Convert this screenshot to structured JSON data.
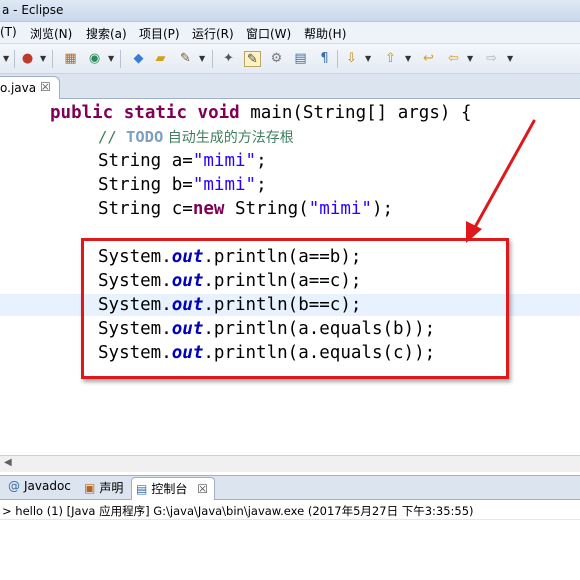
{
  "window": {
    "title": "a - Eclipse"
  },
  "menu": {
    "items": [
      "(T)",
      "浏览(N)",
      "搜索(a)",
      "项目(P)",
      "运行(R)",
      "窗口(W)",
      "帮助(H)"
    ]
  },
  "toolbar": {
    "icons": [
      "package-explorer-icon",
      "run-icon",
      "debug-icon",
      "open-type-icon",
      "open-folder-icon",
      "new-wizard-icon",
      "search-icon",
      "toggle-mark-icon",
      "external-tools-icon",
      "outline-icon",
      "properties-icon",
      "next-annotation-icon",
      "last-edit-icon",
      "back-icon",
      "forward-icon"
    ]
  },
  "editor": {
    "tab_label": "o.java",
    "tab_close": "☒",
    "code": {
      "line1": {
        "kw1": "public",
        "kw2": "static",
        "kw3": "void",
        "rest": " main(String[] args) {"
      },
      "line2": {
        "comment_prefix": "// ",
        "todo": "TODO",
        "comment_text": " 自动生成的方法存根"
      },
      "line3": {
        "type": "String ",
        "var": "a=",
        "str": "\"mimi\"",
        "end": ";"
      },
      "line4": {
        "type": "String ",
        "var": "b=",
        "str": "\"mimi\"",
        "end": ";"
      },
      "line5": {
        "type": "String ",
        "var": "c=",
        "kw": "new",
        "mid": " String(",
        "str": "\"mimi\"",
        "end": ");"
      },
      "line6": {
        "pre": "System.",
        "field": "out",
        "post": ".println(a==b);"
      },
      "line7": {
        "pre": "System.",
        "field": "out",
        "post": ".println(a==c);"
      },
      "line8": {
        "pre": "System.",
        "field": "out",
        "post": ".println(b==c);"
      },
      "line9": {
        "pre": "System.",
        "field": "out",
        "post": ".println(a.equals(b));"
      },
      "line10": {
        "pre": "System.",
        "field": "out",
        "post": ".println(a.equals(c));"
      }
    }
  },
  "bottom_panel": {
    "tabs": [
      {
        "icon": "@",
        "label": "Javadoc"
      },
      {
        "icon": "declaration-icon",
        "label": "声明"
      },
      {
        "icon": "console-icon",
        "label": "控制台",
        "close": "☒"
      }
    ],
    "console_header": "> hello (1) [Java 应用程序] G:\\java\\Java\\bin\\javaw.exe (2017年5月27日 下午3:35:55)"
  },
  "colors": {
    "keyword": "#7f0055",
    "string": "#2a00ff",
    "comment": "#3f7f5f",
    "annotation_red": "#e0171b"
  }
}
